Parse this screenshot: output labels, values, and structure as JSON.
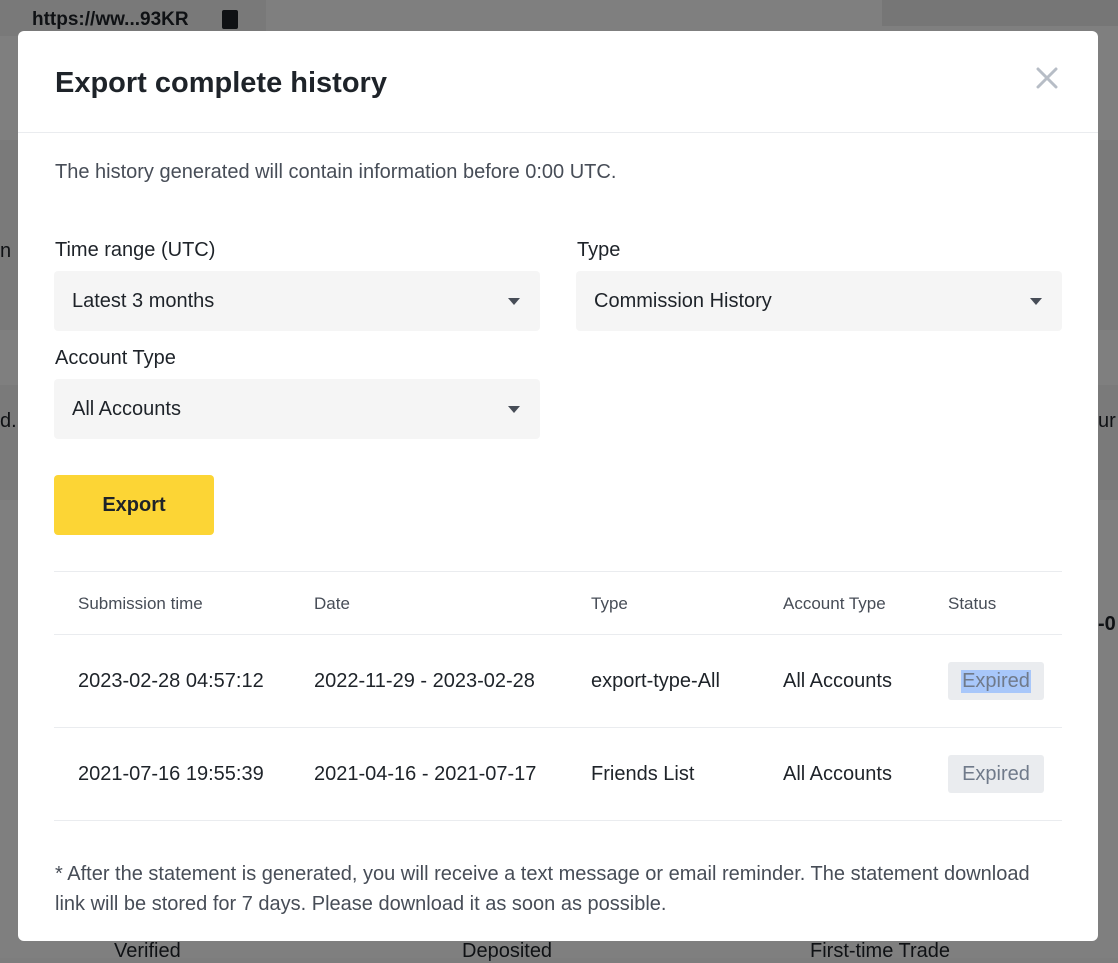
{
  "background": {
    "url_text": "https://ww...93KR",
    "fragment_left_1": "n",
    "fragment_left_2": "d. Y",
    "fragment_right_1": "ur",
    "fragment_right_2": "-0",
    "bottom_labels": [
      "Verified",
      "Deposited",
      "First-time Trade"
    ]
  },
  "modal": {
    "title": "Export complete history",
    "notice": "The history generated will contain information before 0:00 UTC.",
    "time_range": {
      "label": "Time range (UTC)",
      "value": "Latest 3 months"
    },
    "type": {
      "label": "Type",
      "value": "Commission History"
    },
    "account_type": {
      "label": "Account Type",
      "value": "All Accounts"
    },
    "export_label": "Export",
    "table": {
      "headers": [
        "Submission time",
        "Date",
        "Type",
        "Account Type",
        "Status"
      ],
      "rows": [
        {
          "submission_time": "2023-02-28 04:57:12",
          "date": "2022-11-29 - 2023-02-28",
          "type": "export-type-All",
          "account_type": "All Accounts",
          "status": "Expired"
        },
        {
          "submission_time": "2021-07-16 19:55:39",
          "date": "2021-04-16 - 2021-07-17",
          "type": "Friends List",
          "account_type": "All Accounts",
          "status": "Expired"
        }
      ]
    },
    "footnote": "* After the statement is generated, you will receive a text message or email reminder. The statement download link will be stored for 7 days. Please download it as soon as possible."
  },
  "colors": {
    "accent_yellow": "#fcd535",
    "text_primary": "#1e2329",
    "text_secondary": "#474d57",
    "badge_bg": "#eaecef",
    "selection_highlight": "#a8c7fa"
  },
  "icons": [
    "copy-icon",
    "close-icon",
    "chevron-down-icon"
  ]
}
